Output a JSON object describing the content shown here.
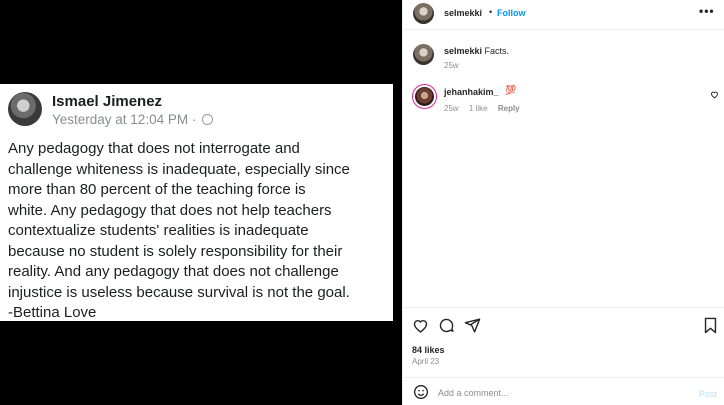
{
  "facebook_post": {
    "author": "Ismael Jimenez",
    "timestamp": "Yesterday at 12:04 PM · ",
    "body": "Any pedagogy that does not interrogate and\nchallenge whiteness is inadequate, especially since\nmore than 80 percent of the teaching force is\nwhite. Any pedagogy that does not help teachers\ncontextualize students' realities is inadequate\nbecause no student is solely responsibility for their\nreality. And any pedagogy that does not challenge\ninjustice is useless because survival is not the goal.\n-Bettina Love"
  },
  "header": {
    "username": "selmekki",
    "separator": "•",
    "follow_label": "Follow",
    "more_label": "•••"
  },
  "caption": {
    "username": "selmekki",
    "text": " Facts.",
    "time": "25w"
  },
  "comment": {
    "username": "jehanhakim_",
    "emoji": "💯",
    "time": "25w",
    "likes": "1 like",
    "reply_label": "Reply"
  },
  "post_meta": {
    "likes": "84 likes",
    "date": "April 23"
  },
  "add_comment": {
    "placeholder": "Add a comment...",
    "post_label": "Post"
  },
  "colors": {
    "accent": "#0095f6",
    "post_disabled": "#b2dffc",
    "text": "#262626",
    "muted": "#8e8e8e"
  },
  "icons": [
    "heart-icon",
    "comment-icon",
    "share-icon",
    "bookmark-icon",
    "emoji-icon",
    "more-icon",
    "globe-icon"
  ]
}
